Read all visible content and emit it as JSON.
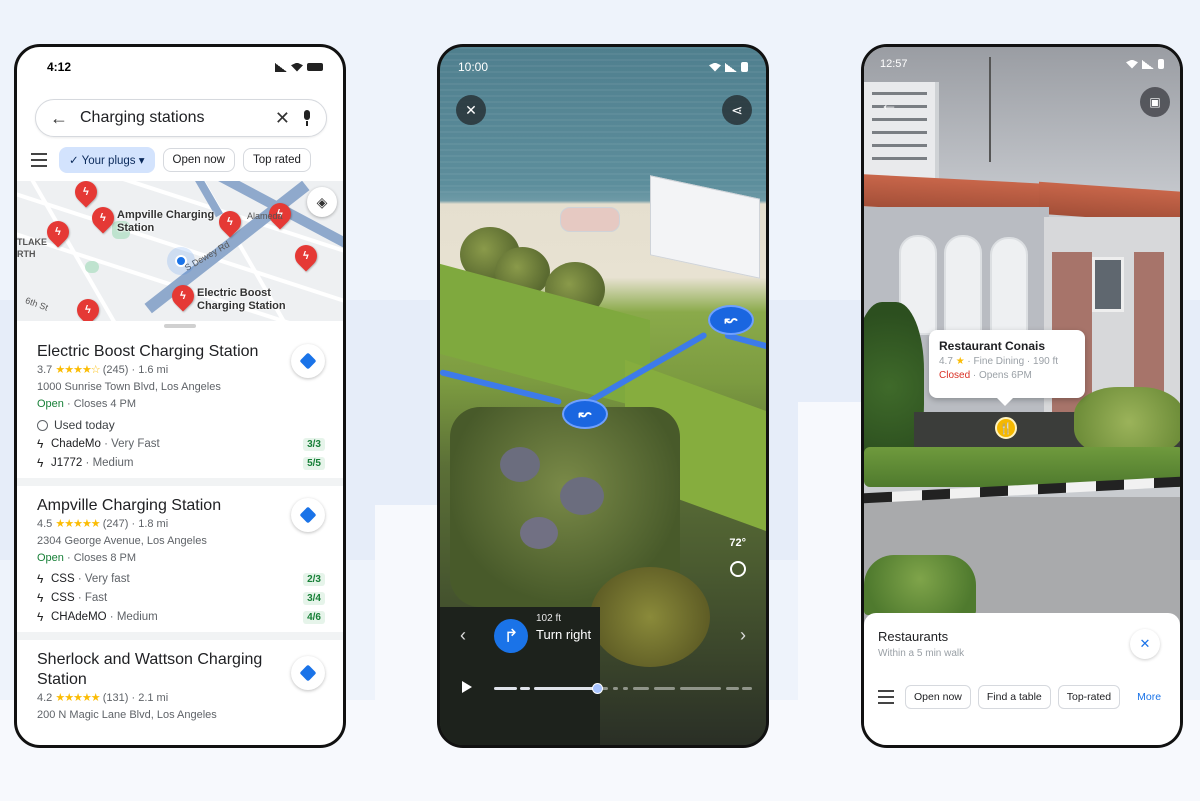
{
  "phone_list": {
    "status_time": "4:12",
    "search": {
      "back_icon": "arrow-left-icon",
      "query": "Charging stations",
      "clear_icon": "close-icon",
      "mic_icon": "mic-icon"
    },
    "chips": [
      {
        "label": "Your plugs",
        "selected": true,
        "has_check": true,
        "has_dropdown": true
      },
      {
        "label": "Open now",
        "selected": false
      },
      {
        "label": "Top rated",
        "selected": false
      }
    ],
    "map": {
      "labels": [
        "Ampville Charging Station",
        "Electric Boost Charging Station"
      ],
      "street_labels": [
        "TLAKE",
        "RTH",
        "S Dewey Rd",
        "Alameda",
        "6th St"
      ]
    },
    "results": [
      {
        "name": "Electric Boost Charging Station",
        "rating": "3.7",
        "stars": "★★★★☆",
        "reviews": "(245)",
        "distance": "1.6 mi",
        "address": "1000 Sunrise Town Blvd, Los Angeles",
        "open": "Open",
        "hours": "Closes 4 PM",
        "used": "Used today",
        "plugs": [
          {
            "name": "ChadeMo",
            "speed": "Very Fast",
            "avail": "3/3"
          },
          {
            "name": "J1772",
            "speed": "Medium",
            "avail": "5/5"
          }
        ]
      },
      {
        "name": "Ampville Charging Station",
        "rating": "4.5",
        "stars": "★★★★★",
        "reviews": "(247)",
        "distance": "1.8 mi",
        "address": "2304 George Avenue, Los Angeles",
        "open": "Open",
        "hours": "Closes 8 PM",
        "plugs": [
          {
            "name": "CSS",
            "speed": "Very fast",
            "avail": "2/3"
          },
          {
            "name": "CSS",
            "speed": "Fast",
            "avail": "3/4"
          },
          {
            "name": "CHAdeMO",
            "speed": "Medium",
            "avail": "4/6"
          }
        ]
      },
      {
        "name": "Sherlock and Wattson Charging Station",
        "rating": "4.2",
        "stars": "★★★★★",
        "reviews": "(131)",
        "distance": "2.1 mi",
        "address": "200 N Magic Lane Blvd, Los Angeles"
      }
    ]
  },
  "phone_immersive": {
    "status_time": "10:00",
    "close_icon": "close-icon",
    "share_icon": "share-icon",
    "temperature": "72°",
    "turn_distance": "102 ft",
    "turn_instruction": "Turn right",
    "progress": 0.4
  },
  "phone_lens": {
    "status_time": "12:57",
    "back_icon": "arrow-left-icon",
    "feedback_icon": "feedback-icon",
    "poi": {
      "name": "Restaurant Conais",
      "rating": "4.7",
      "category": "Fine Dining",
      "distance": "190 ft",
      "status": "Closed",
      "opens": "Opens 6PM"
    },
    "sheet": {
      "title": "Restaurants",
      "subtitle": "Within a 5 min walk",
      "chips": [
        "Open now",
        "Find a table",
        "Top-rated"
      ],
      "more": "More"
    }
  }
}
